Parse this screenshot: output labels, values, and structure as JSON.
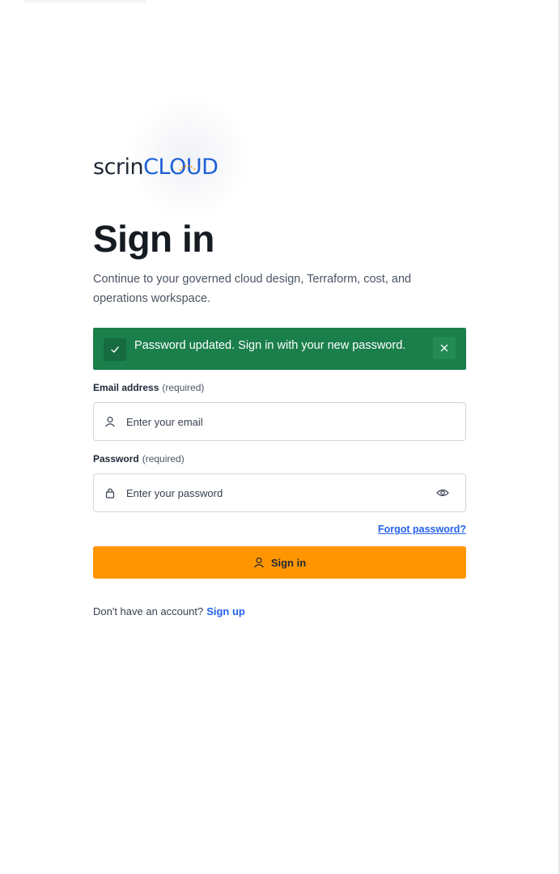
{
  "brand": {
    "logo_part1": "scrin",
    "logo_part2": "CLOUD",
    "accent_color": "#ff9500",
    "brand_blue": "#1d5fd6"
  },
  "page": {
    "title": "Sign in",
    "subtitle": "Continue to your governed cloud design, Terraform, cost, and operations workspace."
  },
  "alert": {
    "message": "Password updated. Sign in with your new password.",
    "icon": "check-icon",
    "close_icon": "close-icon",
    "color": "#1a7f4b"
  },
  "form": {
    "email": {
      "label": "Email address",
      "required_text": "(required)",
      "placeholder": "Enter your email",
      "value": "",
      "icon": "user-icon"
    },
    "password": {
      "label": "Password",
      "required_text": "(required)",
      "placeholder": "Enter your password",
      "value": "",
      "icon": "lock-icon",
      "toggle_icon": "eye-icon"
    },
    "forgot_link": "Forgot password?",
    "submit_label": "Sign in",
    "submit_icon": "user-icon"
  },
  "footer": {
    "prompt": "Don't have an account?",
    "signup_link": "Sign up"
  }
}
